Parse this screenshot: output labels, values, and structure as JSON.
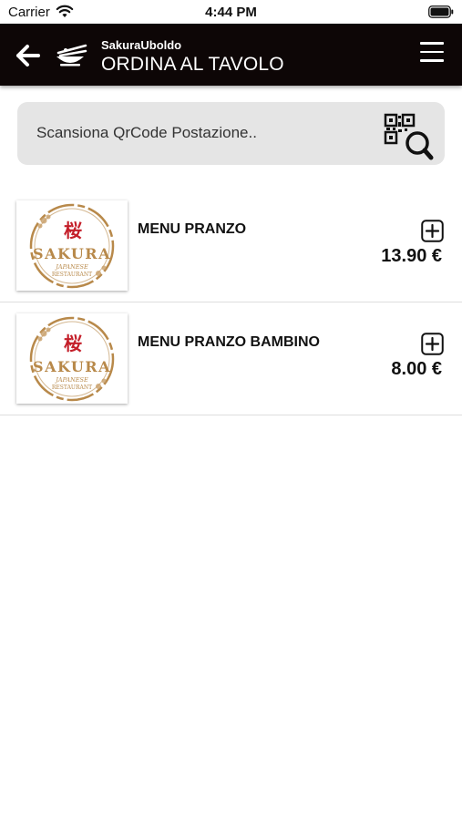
{
  "status_bar": {
    "carrier": "Carrier",
    "time": "4:44 PM"
  },
  "header": {
    "app_name": "SakuraUboldo",
    "title": "ORDINA AL TAVOLO"
  },
  "search": {
    "placeholder": "Scansiona QrCode Postazione.."
  },
  "logo": {
    "main": "SAKURA",
    "sub": "JAPANESE",
    "sub2": "RESTAURANT",
    "glyph": "桜"
  },
  "menu_items": [
    {
      "name": "MENU PRANZO",
      "price": "13.90 €"
    },
    {
      "name": "MENU PRANZO BAMBINO",
      "price": "8.00 €"
    }
  ],
  "colors": {
    "header_bg": "#0d0606",
    "logo_gold": "#b8894a",
    "logo_red": "#c41f2a"
  }
}
